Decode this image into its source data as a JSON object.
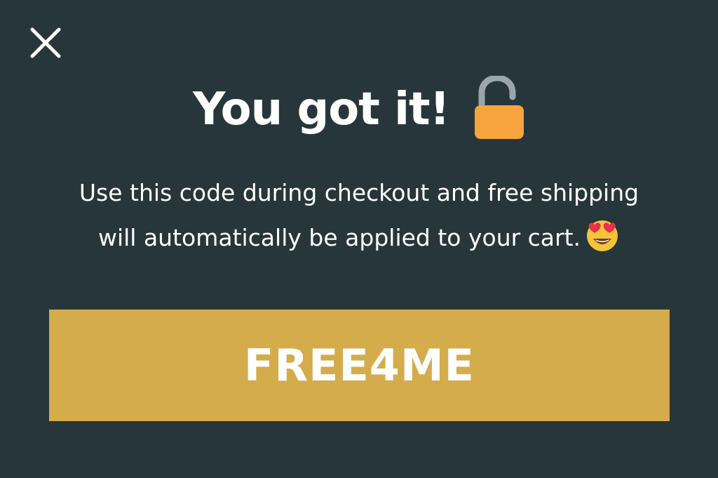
{
  "colors": {
    "background": "#27363b",
    "code_box": "#d4ac4c",
    "text": "#ffffff",
    "lock_body": "#f7a33e",
    "lock_shackle": "#9aa5ad"
  },
  "close": {
    "icon": "close-icon"
  },
  "headline": {
    "title": "You got it!",
    "icon": "open-lock-icon"
  },
  "message": {
    "line1": "Use this code during checkout and free shipping",
    "line2": "will automatically be applied to your cart.",
    "icon": "heart-eyes-emoji-icon"
  },
  "code": {
    "value": "FREE4ME"
  }
}
